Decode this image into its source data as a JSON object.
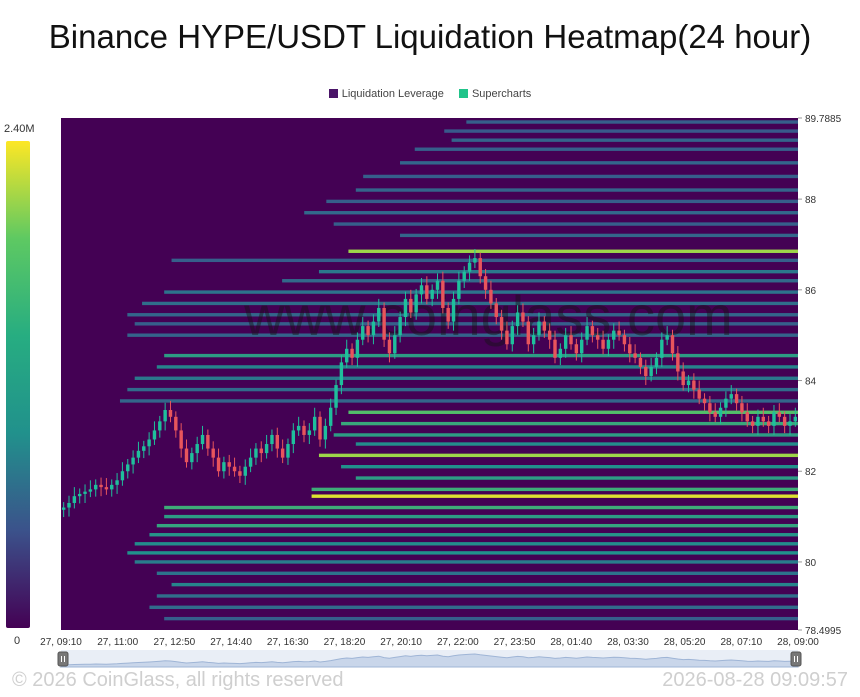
{
  "chart_data": {
    "type": "heatmap",
    "title": "Binance HYPE/USDT Liquidation Heatmap(24 hour)",
    "legend": [
      {
        "label": "Liquidation Leverage",
        "color": "#4a1468"
      },
      {
        "label": "Supercharts",
        "color": "#21c48a"
      }
    ],
    "colorbar": {
      "min_label": "0",
      "max_label": "2.40M",
      "colors": [
        "#440154",
        "#3b528b",
        "#21918c",
        "#5ec962",
        "#fde725"
      ]
    },
    "x_ticks": [
      "27, 09:10",
      "27, 11:00",
      "27, 12:50",
      "27, 14:40",
      "27, 16:30",
      "27, 18:20",
      "27, 20:10",
      "27, 22:00",
      "27, 23:50",
      "28, 01:40",
      "28, 03:30",
      "28, 05:20",
      "28, 07:10",
      "28, 09:00"
    ],
    "y_ticks": [
      {
        "label": "89.7885",
        "value": 89.7885
      },
      {
        "label": "88",
        "value": 88
      },
      {
        "label": "86",
        "value": 86
      },
      {
        "label": "84",
        "value": 84
      },
      {
        "label": "82",
        "value": 82
      },
      {
        "label": "80",
        "value": 80
      },
      {
        "label": "78.4995",
        "value": 78.4995
      }
    ],
    "ylim": [
      78.4995,
      89.7885
    ],
    "bands": [
      {
        "price": 89.7,
        "start": 0.55,
        "level": 0.3
      },
      {
        "price": 89.5,
        "start": 0.52,
        "level": 0.28
      },
      {
        "price": 89.3,
        "start": 0.53,
        "level": 0.32
      },
      {
        "price": 89.1,
        "start": 0.48,
        "level": 0.3
      },
      {
        "price": 88.8,
        "start": 0.46,
        "level": 0.33
      },
      {
        "price": 88.5,
        "start": 0.41,
        "level": 0.3
      },
      {
        "price": 88.2,
        "start": 0.4,
        "level": 0.32
      },
      {
        "price": 87.95,
        "start": 0.36,
        "level": 0.3
      },
      {
        "price": 87.7,
        "start": 0.33,
        "level": 0.34
      },
      {
        "price": 87.45,
        "start": 0.37,
        "level": 0.3
      },
      {
        "price": 87.2,
        "start": 0.46,
        "level": 0.33
      },
      {
        "price": 86.85,
        "start": 0.39,
        "level": 0.85
      },
      {
        "price": 86.65,
        "start": 0.15,
        "level": 0.3
      },
      {
        "price": 86.4,
        "start": 0.35,
        "level": 0.4
      },
      {
        "price": 86.2,
        "start": 0.3,
        "level": 0.34
      },
      {
        "price": 85.95,
        "start": 0.14,
        "level": 0.38
      },
      {
        "price": 85.7,
        "start": 0.11,
        "level": 0.36
      },
      {
        "price": 85.45,
        "start": 0.09,
        "level": 0.33
      },
      {
        "price": 85.25,
        "start": 0.1,
        "level": 0.3
      },
      {
        "price": 85.0,
        "start": 0.09,
        "level": 0.32
      },
      {
        "price": 84.55,
        "start": 0.14,
        "level": 0.55
      },
      {
        "price": 84.3,
        "start": 0.13,
        "level": 0.45
      },
      {
        "price": 84.05,
        "start": 0.1,
        "level": 0.4
      },
      {
        "price": 83.8,
        "start": 0.09,
        "level": 0.35
      },
      {
        "price": 83.55,
        "start": 0.08,
        "level": 0.33
      },
      {
        "price": 83.3,
        "start": 0.39,
        "level": 0.7
      },
      {
        "price": 83.05,
        "start": 0.38,
        "level": 0.6
      },
      {
        "price": 82.8,
        "start": 0.37,
        "level": 0.55
      },
      {
        "price": 82.6,
        "start": 0.4,
        "level": 0.48
      },
      {
        "price": 82.35,
        "start": 0.35,
        "level": 0.85
      },
      {
        "price": 82.1,
        "start": 0.38,
        "level": 0.5
      },
      {
        "price": 81.85,
        "start": 0.4,
        "level": 0.55
      },
      {
        "price": 81.6,
        "start": 0.34,
        "level": 0.62
      },
      {
        "price": 81.45,
        "start": 0.34,
        "level": 0.95
      },
      {
        "price": 81.2,
        "start": 0.14,
        "level": 0.62
      },
      {
        "price": 81.0,
        "start": 0.14,
        "level": 0.55
      },
      {
        "price": 80.8,
        "start": 0.13,
        "level": 0.58
      },
      {
        "price": 80.6,
        "start": 0.12,
        "level": 0.52
      },
      {
        "price": 80.4,
        "start": 0.1,
        "level": 0.48
      },
      {
        "price": 80.2,
        "start": 0.09,
        "level": 0.5
      },
      {
        "price": 80.0,
        "start": 0.1,
        "level": 0.42
      },
      {
        "price": 79.75,
        "start": 0.13,
        "level": 0.38
      },
      {
        "price": 79.5,
        "start": 0.15,
        "level": 0.45
      },
      {
        "price": 79.25,
        "start": 0.13,
        "level": 0.36
      },
      {
        "price": 79.0,
        "start": 0.12,
        "level": 0.35
      },
      {
        "price": 78.75,
        "start": 0.14,
        "level": 0.3
      }
    ],
    "price_series": [
      81.2,
      81.3,
      81.45,
      81.5,
      81.55,
      81.6,
      81.7,
      81.65,
      81.6,
      81.7,
      81.8,
      82.0,
      82.15,
      82.3,
      82.45,
      82.55,
      82.7,
      82.9,
      83.1,
      83.35,
      83.2,
      82.9,
      82.5,
      82.2,
      82.4,
      82.6,
      82.8,
      82.5,
      82.3,
      82.0,
      82.2,
      82.1,
      82.0,
      81.9,
      82.1,
      82.3,
      82.5,
      82.4,
      82.6,
      82.8,
      82.5,
      82.3,
      82.6,
      82.9,
      83.0,
      82.8,
      82.9,
      83.2,
      82.7,
      83.0,
      83.4,
      83.9,
      84.4,
      84.7,
      84.5,
      84.9,
      85.2,
      85.0,
      85.3,
      85.6,
      84.9,
      84.6,
      85.0,
      85.4,
      85.8,
      85.5,
      85.9,
      86.1,
      85.8,
      86.0,
      86.2,
      85.6,
      85.3,
      85.8,
      86.2,
      86.4,
      86.6,
      86.7,
      86.3,
      86.0,
      85.7,
      85.4,
      85.1,
      84.8,
      85.2,
      85.5,
      85.3,
      84.8,
      85.0,
      85.3,
      85.1,
      84.9,
      84.5,
      84.7,
      85.0,
      84.8,
      84.6,
      84.9,
      85.2,
      85.0,
      84.9,
      84.7,
      84.9,
      85.1,
      85.0,
      84.8,
      84.6,
      84.5,
      84.3,
      84.1,
      84.3,
      84.5,
      84.9,
      85.0,
      84.6,
      84.2,
      83.9,
      84.0,
      83.8,
      83.6,
      83.5,
      83.3,
      83.2,
      83.4,
      83.6,
      83.7,
      83.5,
      83.3,
      83.1,
      83.0,
      83.2,
      83.1,
      83.0,
      83.3,
      83.2,
      83.0,
      83.1,
      83.2
    ],
    "watermark": "www.coinglass.com"
  },
  "footer": {
    "copyright": "© 2026 CoinGlass, all rights reserved",
    "timestamp": "2026-08-28 09:09:57"
  }
}
